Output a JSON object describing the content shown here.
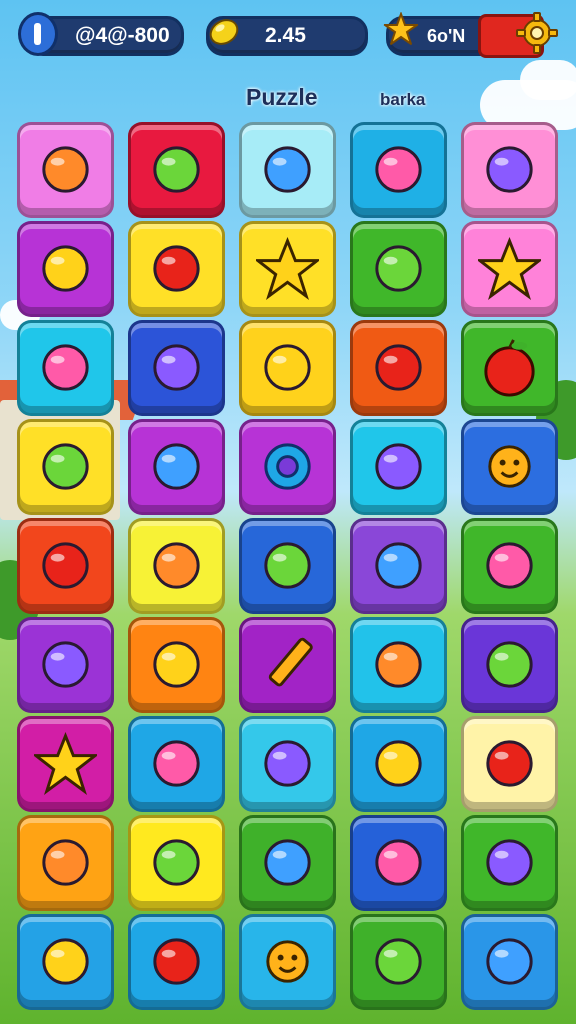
{
  "hud": {
    "score": "@4@-800",
    "coins": "2.45",
    "stars": "6o'N"
  },
  "headings": {
    "title": "Puzzle",
    "subtitle": "barka"
  },
  "tiles": [
    {
      "color": "#f07de6",
      "icon": "palm-icon"
    },
    {
      "color": "#e8193f",
      "icon": "brush-icon"
    },
    {
      "color": "#a7ecf7",
      "icon": "mushroom-hammer-icon"
    },
    {
      "color": "#1fb0e6",
      "icon": "flashlight-icon"
    },
    {
      "color": "#ff8fd6",
      "icon": "box-icon"
    },
    {
      "color": "#b733d6",
      "icon": "cross-tools-icon"
    },
    {
      "color": "#ffe027",
      "icon": "balloon-icon"
    },
    {
      "color": "#ffe027",
      "icon": "star-icon"
    },
    {
      "color": "#40b72a",
      "icon": "snail-icon"
    },
    {
      "color": "#ff82d9",
      "icon": "star-icon"
    },
    {
      "color": "#20c6ea",
      "icon": "ball-icon"
    },
    {
      "color": "#2c54d8",
      "icon": "ghost-icon"
    },
    {
      "color": "#ffd21c",
      "icon": "shell-icon"
    },
    {
      "color": "#f05a14",
      "icon": "book-icon"
    },
    {
      "color": "#40b72a",
      "icon": "apple-icon"
    },
    {
      "color": "#ffe027",
      "icon": "bow-icon"
    },
    {
      "color": "#b733d6",
      "icon": "lime-icon"
    },
    {
      "color": "#b733d6",
      "icon": "gear-icon"
    },
    {
      "color": "#20c6ea",
      "icon": "hammer-icon"
    },
    {
      "color": "#2c6ee0",
      "icon": "sun-icon"
    },
    {
      "color": "#f2461c",
      "icon": "fan-icon"
    },
    {
      "color": "#f7f236",
      "icon": "pill-icon"
    },
    {
      "color": "#2767d9",
      "icon": "chest-icon"
    },
    {
      "color": "#8a47d8",
      "icon": "leaf-icon"
    },
    {
      "color": "#40b72a",
      "icon": "crate-icon"
    },
    {
      "color": "#9b33d6",
      "icon": "drop-icon"
    },
    {
      "color": "#ff8412",
      "icon": "radish-icon"
    },
    {
      "color": "#a223c6",
      "icon": "pencil-icon"
    },
    {
      "color": "#22c2ea",
      "icon": "face-icon"
    },
    {
      "color": "#6a36d8",
      "icon": "cup-icon"
    },
    {
      "color": "#d21ea6",
      "icon": "star-icon"
    },
    {
      "color": "#1fa7e6",
      "icon": "cross-wand-icon"
    },
    {
      "color": "#34c8ea",
      "icon": "key-icon"
    },
    {
      "color": "#1fa7e6",
      "icon": "flower-icon"
    },
    {
      "color": "#fff3a8",
      "icon": "bird-icon"
    },
    {
      "color": "#ffa314",
      "icon": "robot-icon"
    },
    {
      "color": "#ffe91f",
      "icon": "pin-icon"
    },
    {
      "color": "#3fb12a",
      "icon": "crayon-icon"
    },
    {
      "color": "#2561d9",
      "icon": "mango-icon"
    },
    {
      "color": "#40b72a",
      "icon": "pen-icon"
    },
    {
      "color": "#24a2e6",
      "icon": "orbit-icon"
    },
    {
      "color": "#1fa7e6",
      "icon": "gift-icon"
    },
    {
      "color": "#28b5ea",
      "icon": "sun-icon"
    },
    {
      "color": "#3fb12a",
      "icon": "lamp-icon"
    },
    {
      "color": "#2a96e8",
      "icon": "cone-icon"
    }
  ]
}
